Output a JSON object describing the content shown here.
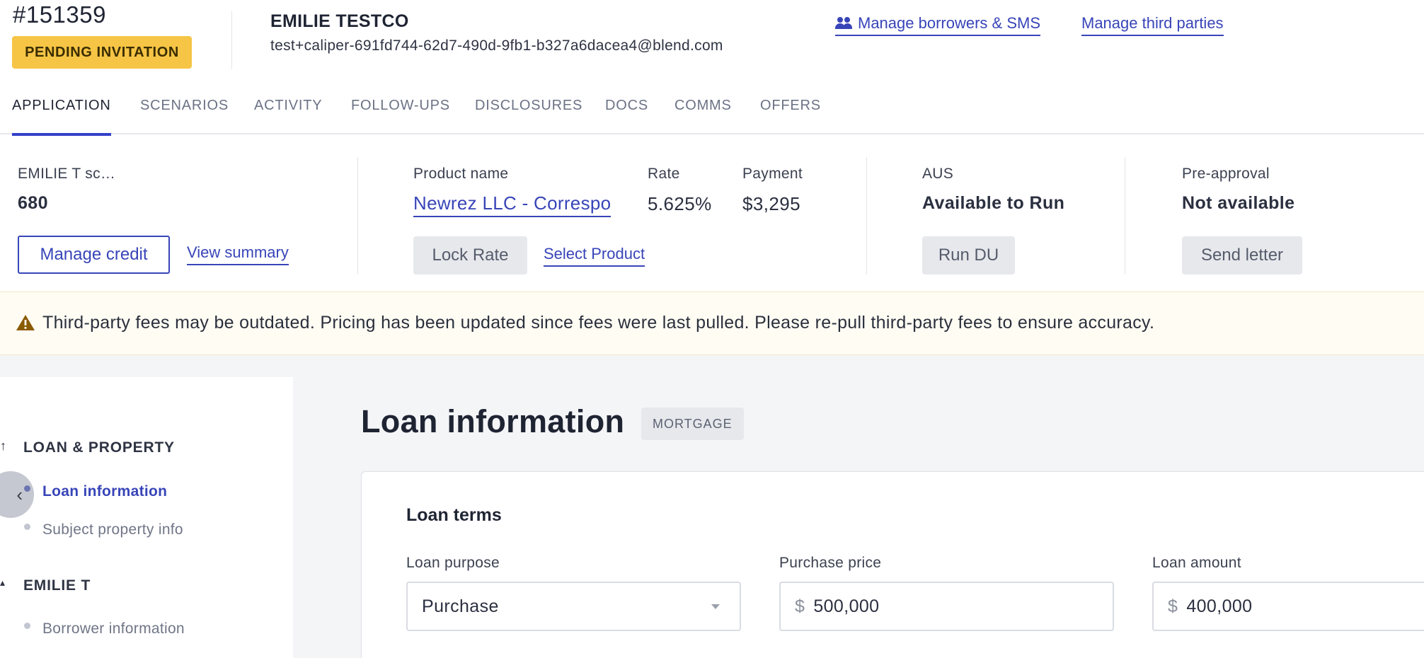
{
  "header": {
    "loan_id": "#151359",
    "status_badge": "PENDING INVITATION",
    "borrower_name": "EMILIE TESTCO",
    "borrower_email": "test+caliper-691fd744-62d7-490d-9fb1-b327a6dacea4@blend.com",
    "manage_borrowers_label": "Manage borrowers & SMS",
    "manage_third_parties_label": "Manage third parties"
  },
  "tabs": [
    {
      "label": "APPLICATION",
      "active": true
    },
    {
      "label": "SCENARIOS"
    },
    {
      "label": "ACTIVITY"
    },
    {
      "label": "FOLLOW-UPS"
    },
    {
      "label": "DISCLOSURES"
    },
    {
      "label": "DOCS"
    },
    {
      "label": "COMMS"
    },
    {
      "label": "OFFERS"
    }
  ],
  "summary": {
    "credit": {
      "label": "EMILIE T sc…",
      "score": "680",
      "manage_credit_label": "Manage credit",
      "view_summary_label": "View summary"
    },
    "product": {
      "name_label": "Product name",
      "name_value": "Newrez LLC - Correspo",
      "rate_label": "Rate",
      "rate_value": "5.625%",
      "payment_label": "Payment",
      "payment_value": "$3,295",
      "lock_rate_label": "Lock Rate",
      "select_product_label": "Select Product"
    },
    "aus": {
      "label": "AUS",
      "value": "Available to Run",
      "run_du_label": "Run DU"
    },
    "preapproval": {
      "label": "Pre-approval",
      "value": "Not available",
      "send_letter_label": "Send letter"
    }
  },
  "warning": {
    "text": "Third-party fees may be outdated. Pricing has been updated since fees were last pulled. Please re-pull third-party fees to ensure accuracy."
  },
  "sidebar": {
    "sections": [
      {
        "title": "LOAN & PROPERTY",
        "items": [
          "Loan information",
          "Subject property info"
        ]
      },
      {
        "title": "EMILIE T",
        "items": [
          "Borrower information"
        ]
      }
    ],
    "active_item": "Loan information"
  },
  "main": {
    "title": "Loan information",
    "tag": "MORTGAGE",
    "card_title": "Loan terms",
    "fields": [
      {
        "label": "Loan purpose",
        "value": "Purchase",
        "type": "select"
      },
      {
        "label": "Purchase price",
        "prefix": "$",
        "value": "500,000"
      },
      {
        "label": "Loan amount",
        "prefix": "$",
        "value": "400,000"
      }
    ]
  },
  "colors": {
    "accent": "#3845b8",
    "badge": "#f6c545",
    "warning_bg": "#fffcf3",
    "warning_icon": "#8a5a00"
  },
  "icons": {
    "borrowers": "people-icon",
    "warning": "warning-triangle-icon",
    "collapse": "chevron-left-icon",
    "select": "caret-down-icon"
  }
}
